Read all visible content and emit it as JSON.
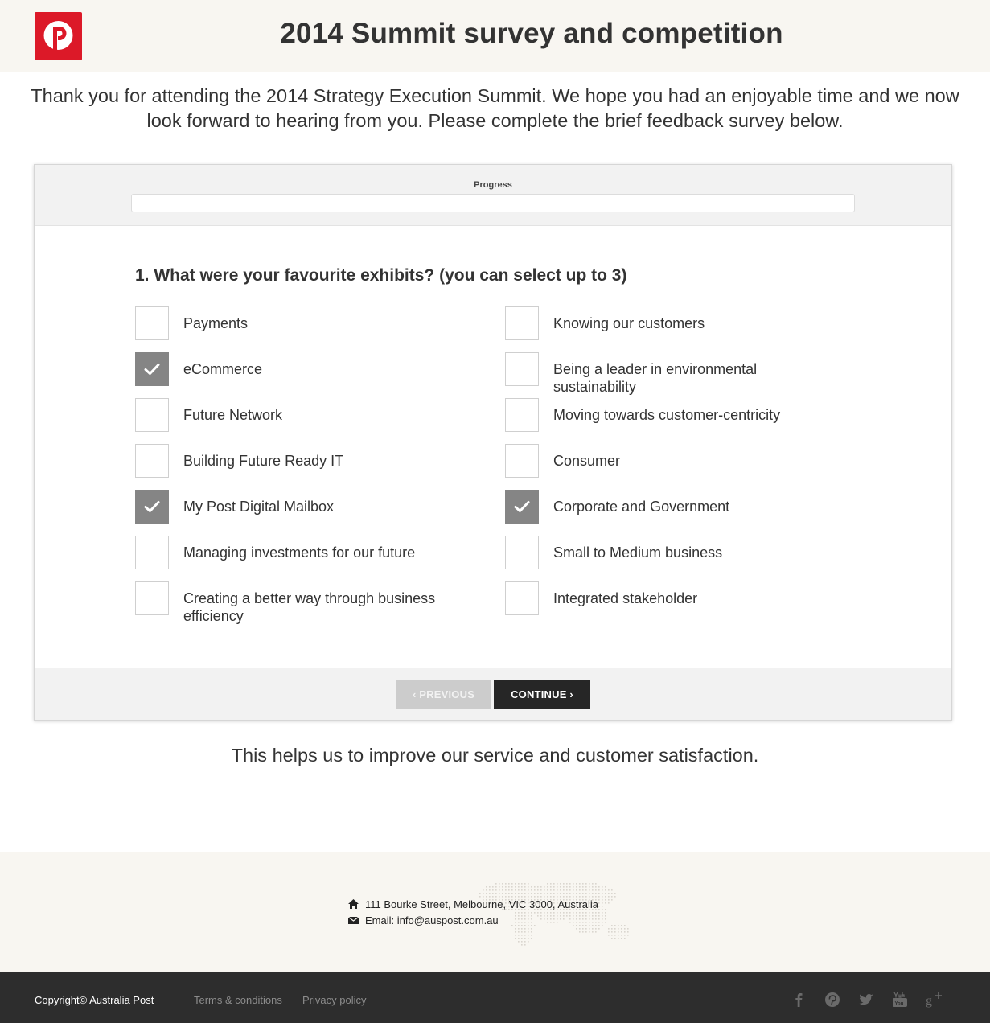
{
  "header": {
    "logo": "Australia Post logo",
    "title": "2014 Summit survey and competition"
  },
  "intro": "Thank you for attending the 2014 Strategy Execution Summit. We hope you had an enjoyable time and we now look forward to hearing from you. Please complete the brief feedback survey below.",
  "survey": {
    "progress_label": "Progress",
    "progress_fraction": 0,
    "question": "1. What were your favourite exhibits? (you can select up to 3)",
    "options_left": [
      {
        "label": "Payments",
        "checked": false
      },
      {
        "label": "eCommerce",
        "checked": true
      },
      {
        "label": "Future Network",
        "checked": false
      },
      {
        "label": "Building Future Ready IT",
        "checked": false
      },
      {
        "label": "My Post Digital Mailbox",
        "checked": true
      },
      {
        "label": "Managing investments for our future",
        "checked": false
      },
      {
        "label": "Creating a better way through business efficiency",
        "checked": false
      }
    ],
    "options_right": [
      {
        "label": "Knowing our customers",
        "checked": false
      },
      {
        "label": "Being a leader in environmental sustainability",
        "checked": false
      },
      {
        "label": "Moving towards customer-centricity",
        "checked": false
      },
      {
        "label": "Consumer",
        "checked": false
      },
      {
        "label": "Corporate and Government",
        "checked": true
      },
      {
        "label": "Small to Medium business",
        "checked": false
      },
      {
        "label": "Integrated stakeholder",
        "checked": false
      }
    ],
    "previous_label": "‹ PREVIOUS",
    "continue_label": "CONTINUE ›"
  },
  "closing": "This helps us to improve our service and customer satisfaction.",
  "footer": {
    "address": "111 Bourke Street, Melbourne, VIC 3000, Australia",
    "email": "Email: info@auspost.com.au",
    "copyright": "Copyright© Australia Post",
    "links": [
      "Terms & conditions",
      "Privacy policy"
    ],
    "social": [
      "facebook-icon",
      "pinterest-icon",
      "twitter-icon",
      "youtube-icon",
      "google-plus-icon"
    ]
  },
  "colors": {
    "brand_red": "#dc1928",
    "checked_box": "#858585",
    "continue_button": "#262626",
    "previous_button": "#cccccc",
    "footer_dark": "#2d2d2d",
    "footer_light": "#f8f6f1"
  }
}
